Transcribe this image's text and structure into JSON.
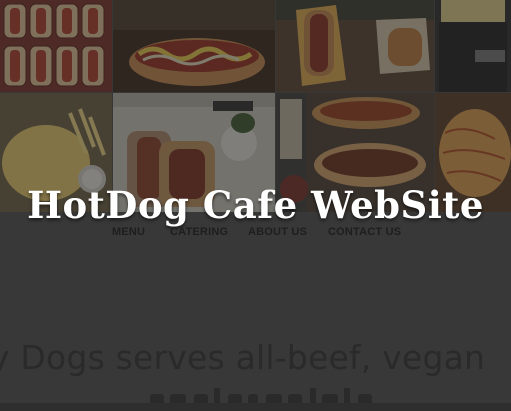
{
  "header": {
    "title": "HotDog Cafe WebSite"
  },
  "nav": {
    "items": [
      {
        "label": "MENU"
      },
      {
        "label": "CATERING"
      },
      {
        "label": "ABOUT US"
      },
      {
        "label": "CONTACT US"
      }
    ]
  },
  "intro": {
    "line1": "y Dogs serves all-beef, vegan",
    "line2": "                              "
  },
  "colors": {
    "overlay": "#282828",
    "title": "#ffffff",
    "nav_text": "#1e1e1e",
    "intro_text": "#2a2a2a"
  }
}
